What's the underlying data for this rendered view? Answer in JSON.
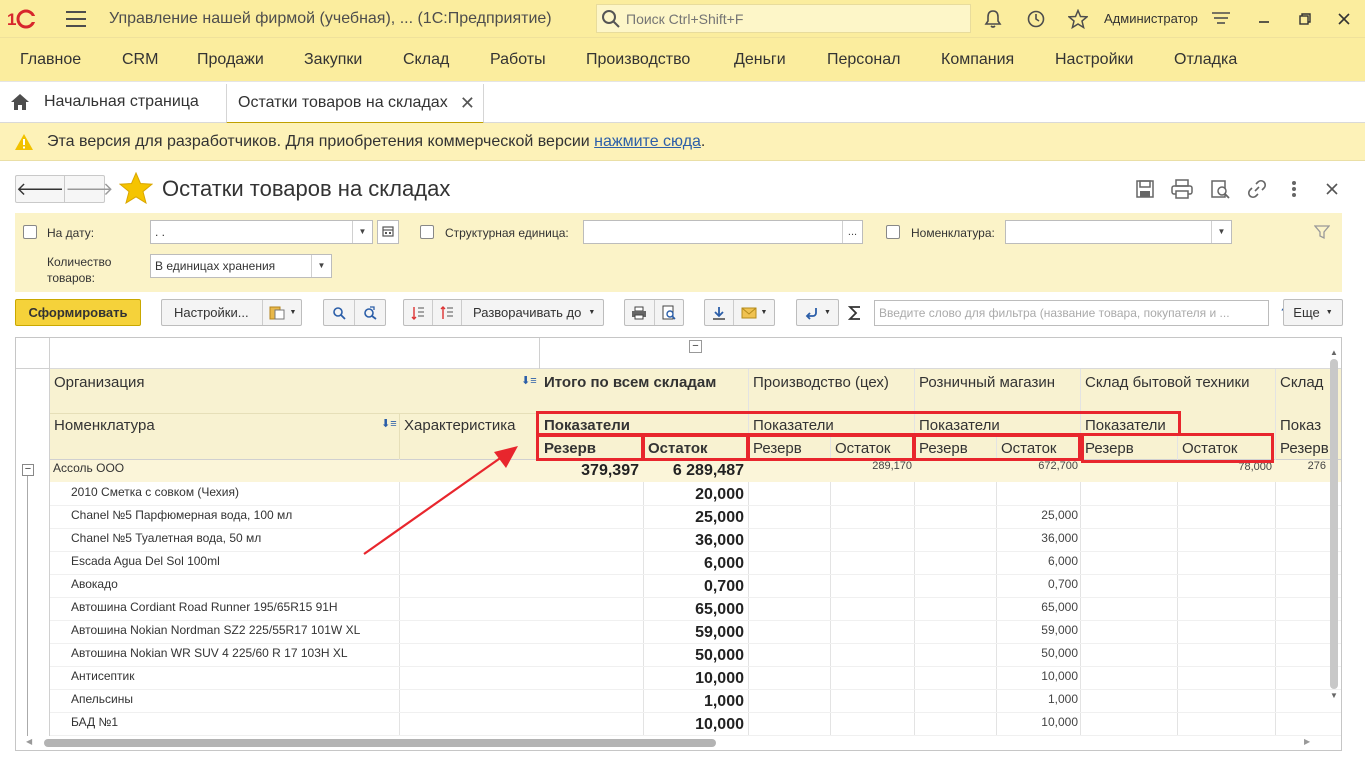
{
  "app": {
    "title": "Управление нашей фирмой (учебная), ...  (1С:Предприятие)",
    "search_placeholder": "Поиск Ctrl+Shift+F",
    "user": "Администратор"
  },
  "menu": [
    "Главное",
    "CRM",
    "Продажи",
    "Закупки",
    "Склад",
    "Работы",
    "Производство",
    "Деньги",
    "Персонал",
    "Компания",
    "Настройки",
    "Отладка"
  ],
  "tabs": {
    "home": "Начальная страница",
    "active": "Остатки товаров на складах"
  },
  "banner": {
    "text": "Эта версия для разработчиков. Для приобретения коммерческой версии",
    "link": "нажмите сюда",
    "tail": "."
  },
  "form": {
    "title": "Остатки товаров на складах"
  },
  "filters": {
    "date_label": "На дату:",
    "date_value": " .  .",
    "unit_label": "Структурная единица:",
    "unit_value": "",
    "nom_label": "Номенклатура:",
    "nom_value": "",
    "qty_label_1": "Количество",
    "qty_label_2": "товаров:",
    "qty_value": "В единицах хранения"
  },
  "toolbar": {
    "generate": "Сформировать",
    "settings": "Настройки...",
    "expand_to": "Разворачивать до",
    "filter_placeholder": "Введите слово для фильтра (название товара, покупателя и ...",
    "help": "?",
    "more": "Еще"
  },
  "report": {
    "col_org": "Организация",
    "col_nom": "Номенклатура",
    "col_char": "Характеристика",
    "warehouses": [
      "Итого по всем складам",
      "Производство (цех)",
      "Розничный магазин",
      "Склад бытовой техники",
      "Склад"
    ],
    "indicators": "Показатели",
    "indicators_short": "Показ",
    "reserve": "Резерв",
    "reserve_short": "Резерв",
    "balance": "Остаток",
    "collapse_marker": "−",
    "total_row": {
      "name": "Ассоль ООО",
      "total_reserve": "379,397",
      "total_balance": "6 289,487",
      "w1_balance": "289,170",
      "w2_balance": "672,700",
      "w3_balance": "78,000",
      "w4_reserve": "276"
    },
    "rows": [
      {
        "name": "2010 Сметка с совком (Чехия)",
        "total": "20,000",
        "retail": ""
      },
      {
        "name": "Chanel №5 Парфюмерная вода, 100 мл",
        "total": "25,000",
        "retail": "25,000"
      },
      {
        "name": "Chanel №5 Туалетная вода, 50 мл",
        "total": "36,000",
        "retail": "36,000"
      },
      {
        "name": "Escada Agua Del Sol 100ml",
        "total": "6,000",
        "retail": "6,000"
      },
      {
        "name": "Авокадо",
        "total": "0,700",
        "retail": "0,700"
      },
      {
        "name": "Автошина Cordiant Road Runner 195/65R15 91H",
        "total": "65,000",
        "retail": "65,000"
      },
      {
        "name": "Автошина Nokian Nordman SZ2 225/55R17 101W XL",
        "total": "59,000",
        "retail": "59,000"
      },
      {
        "name": "Автошина Nokian WR SUV 4 225/60 R 17 103H XL",
        "total": "50,000",
        "retail": "50,000"
      },
      {
        "name": "Антисептик",
        "total": "10,000",
        "retail": "10,000"
      },
      {
        "name": "Апельсины",
        "total": "1,000",
        "retail": "1,000"
      },
      {
        "name": "БАД №1",
        "total": "10,000",
        "retail": "10,000"
      }
    ]
  },
  "colors": {
    "accent": "#fbed9e",
    "banner": "#fdf2b8",
    "primary_button": "#f5d23a",
    "highlight": "#e8262d"
  }
}
